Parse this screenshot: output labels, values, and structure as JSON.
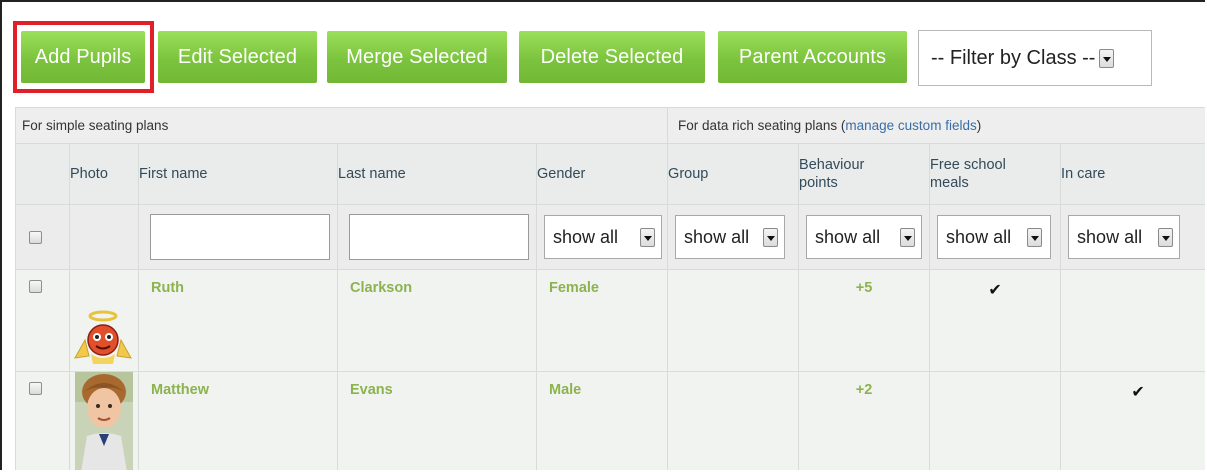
{
  "toolbar": {
    "buttons": [
      "Add Pupils",
      "Edit Selected",
      "Merge Selected",
      "Delete Selected",
      "Parent Accounts"
    ],
    "filter_value": "-- Filter by Class --",
    "highlight_color": "#e01f28",
    "button_color": "#7cc33e"
  },
  "table": {
    "section_simple": "For simple seating plans",
    "section_rich_prefix": "For data rich seating plans (",
    "section_rich_link": "manage custom fields",
    "section_rich_suffix": ")",
    "columns": [
      "Photo",
      "First name",
      "Last name",
      "Gender",
      "Group",
      "Behaviour points",
      "Free school meals",
      "In care"
    ],
    "filters": {
      "gender": "show all",
      "group": "show all",
      "behaviour": "show all",
      "fsm": "show all",
      "in_care": "show all"
    },
    "rows": [
      {
        "photo": "angel-avatar",
        "first": "Ruth",
        "last": "Clarkson",
        "gender": "Female",
        "group": "",
        "behaviour": "+5",
        "fsm": "✔",
        "in_care": ""
      },
      {
        "photo": "boy-photo",
        "first": "Matthew",
        "last": "Evans",
        "gender": "Male",
        "group": "",
        "behaviour": "+2",
        "fsm": "",
        "in_care": "✔"
      }
    ]
  }
}
